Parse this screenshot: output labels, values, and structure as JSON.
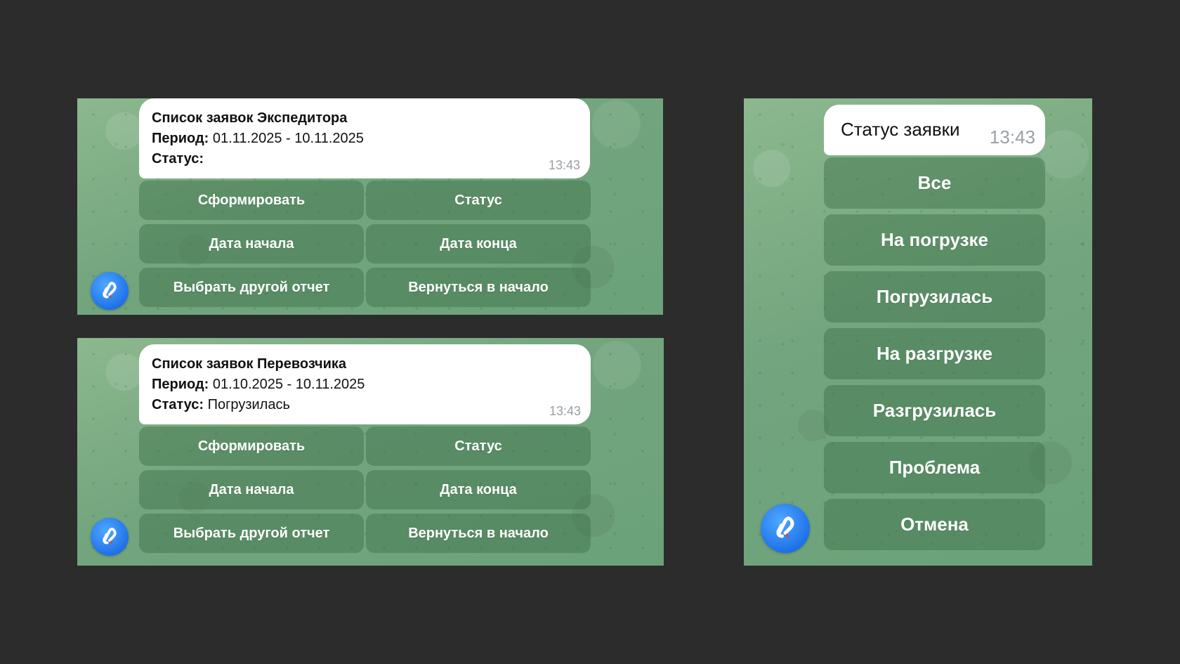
{
  "panels": [
    {
      "message": {
        "title": "Список заявок Экспедитора",
        "period_label": "Период:",
        "period_value": "01.11.2025 - 10.11.2025",
        "status_label": "Статус:",
        "status_value": "",
        "time": "13:43"
      },
      "buttons": {
        "form": "Сформировать",
        "status": "Статус",
        "start_date": "Дата начала",
        "end_date": "Дата конца",
        "other_report": "Выбрать другой отчет",
        "back_to_start": "Вернуться в начало"
      }
    },
    {
      "message": {
        "title": "Список заявок Перевозчика",
        "period_label": "Период:",
        "period_value": "01.10.2025 - 10.11.2025",
        "status_label": "Статус:",
        "status_value": "Погрузилась",
        "time": "13:43"
      },
      "buttons": {
        "form": "Сформировать",
        "status": "Статус",
        "start_date": "Дата начала",
        "end_date": "Дата конца",
        "other_report": "Выбрать другой отчет",
        "back_to_start": "Вернуться в начало"
      }
    }
  ],
  "status_panel": {
    "message": {
      "title": "Статус заявки",
      "time": "13:43"
    },
    "options": [
      "Все",
      "На погрузке",
      "Погрузилась",
      "На разгрузке",
      "Разгрузилась",
      "Проблема",
      "Отмена"
    ]
  },
  "colors": {
    "page_background": "#2c2c2c",
    "chat_background": "#73a57e",
    "bubble": "#ffffff",
    "avatar": "#1f72e8"
  },
  "icons": {
    "avatar": "bot-logo-icon"
  }
}
